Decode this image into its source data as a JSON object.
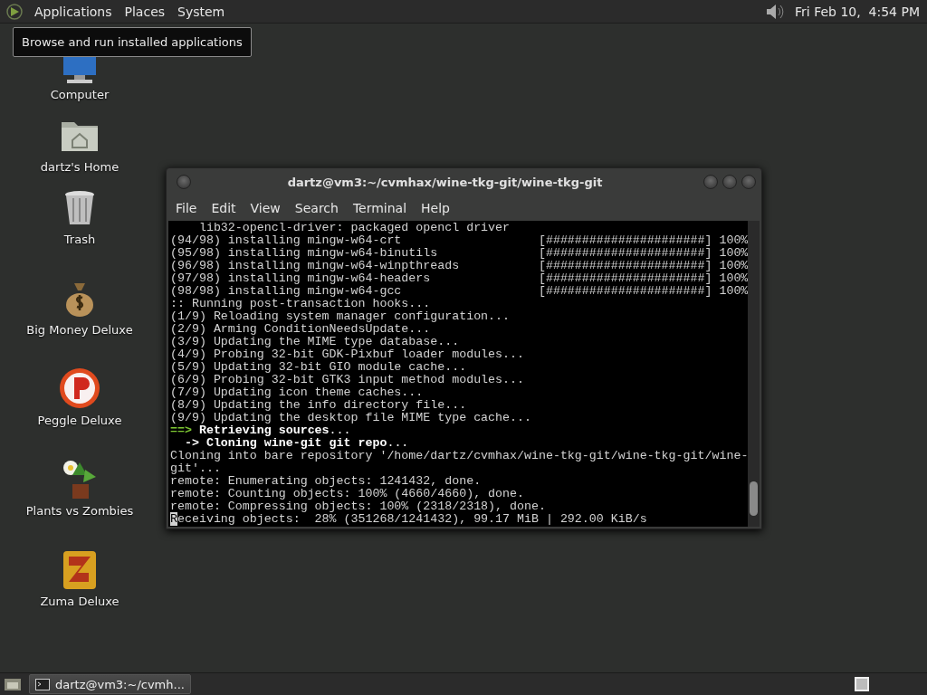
{
  "top_panel": {
    "menus": [
      "Applications",
      "Places",
      "System"
    ],
    "clock": "Fri Feb 10,  4:54 PM"
  },
  "tooltip": "Browse and run installed applications",
  "desktop_icons": [
    {
      "label": "Computer",
      "kind": "computer"
    },
    {
      "label": "dartz's Home",
      "kind": "home"
    },
    {
      "label": "Trash",
      "kind": "trash"
    },
    {
      "label": "Big Money Deluxe",
      "kind": "money"
    },
    {
      "label": "Peggle Deluxe",
      "kind": "peggle"
    },
    {
      "label": "Plants vs Zombies",
      "kind": "plants"
    },
    {
      "label": "Zuma Deluxe",
      "kind": "zuma"
    }
  ],
  "window": {
    "title": "dartz@vm3:~/cvmhax/wine-tkg-git/wine-tkg-git",
    "menus": [
      "File",
      "Edit",
      "View",
      "Search",
      "Terminal",
      "Help"
    ],
    "lines": [
      {
        "kind": "text",
        "text": "    lib32-opencl-driver: packaged opencl driver"
      },
      {
        "kind": "progress",
        "text": "(94/98) installing mingw-w64-crt",
        "bar": "[######################]",
        "percent": "100%"
      },
      {
        "kind": "progress",
        "text": "(95/98) installing mingw-w64-binutils",
        "bar": "[######################]",
        "percent": "100%"
      },
      {
        "kind": "progress",
        "text": "(96/98) installing mingw-w64-winpthreads",
        "bar": "[######################]",
        "percent": "100%"
      },
      {
        "kind": "progress",
        "text": "(97/98) installing mingw-w64-headers",
        "bar": "[######################]",
        "percent": "100%"
      },
      {
        "kind": "progress",
        "text": "(98/98) installing mingw-w64-gcc",
        "bar": "[######################]",
        "percent": "100%"
      },
      {
        "kind": "text",
        "text": ":: Running post-transaction hooks..."
      },
      {
        "kind": "text",
        "text": "(1/9) Reloading system manager configuration..."
      },
      {
        "kind": "text",
        "text": "(2/9) Arming ConditionNeedsUpdate..."
      },
      {
        "kind": "text",
        "text": "(3/9) Updating the MIME type database..."
      },
      {
        "kind": "text",
        "text": "(4/9) Probing 32-bit GDK-Pixbuf loader modules..."
      },
      {
        "kind": "text",
        "text": "(5/9) Updating 32-bit GIO module cache..."
      },
      {
        "kind": "text",
        "text": "(6/9) Probing 32-bit GTK3 input method modules..."
      },
      {
        "kind": "text",
        "text": "(7/9) Updating icon theme caches..."
      },
      {
        "kind": "text",
        "text": "(8/9) Updating the info directory file..."
      },
      {
        "kind": "text",
        "text": "(9/9) Updating the desktop file MIME type cache..."
      },
      {
        "kind": "step",
        "prefix": "==>",
        "text": "**Retrieving sources**..."
      },
      {
        "kind": "substep",
        "prefix": "  ->",
        "text": "**Cloning wine-git git repo**..."
      },
      {
        "kind": "text",
        "text": "Cloning into bare repository '/home/dartz/cvmhax/wine-tkg-git/wine-tkg-git/wine-"
      },
      {
        "kind": "text",
        "text": "git'..."
      },
      {
        "kind": "text",
        "text": "remote: Enumerating objects: 1241432, done."
      },
      {
        "kind": "text",
        "text": "remote: Counting objects: 100% (4660/4660), done."
      },
      {
        "kind": "text",
        "text": "remote: Compressing objects: 100% (2318/2318), done."
      },
      {
        "kind": "text",
        "text": "Receiving objects:  28% (351268/1241432), 99.17 MiB | 292.00 KiB/s",
        "cursor": true
      }
    ]
  },
  "taskbar": {
    "tasks": [
      {
        "label": "dartz@vm3:~/cvmh...",
        "selected": false
      }
    ]
  }
}
